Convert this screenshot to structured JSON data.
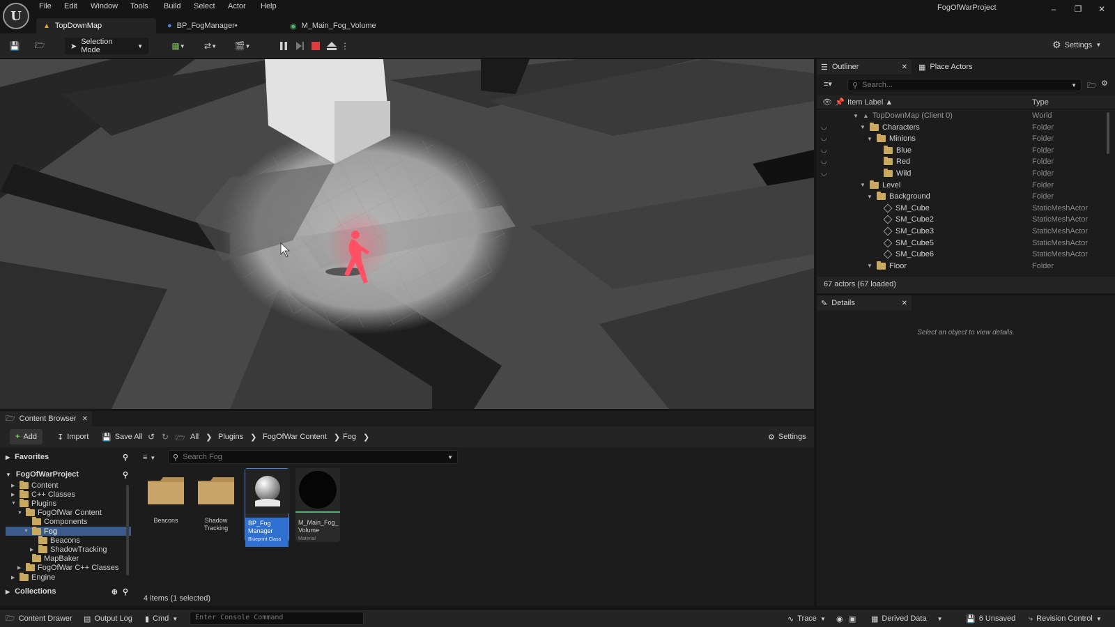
{
  "app": {
    "project_title": "FogOfWarProject",
    "menu": [
      "File",
      "Edit",
      "Window",
      "Tools",
      "Build",
      "Select",
      "Actor",
      "Help"
    ],
    "tabs": [
      {
        "label": "TopDownMap",
        "icon": "level-icon",
        "active": true
      },
      {
        "label": "BP_FogManager•",
        "icon": "blueprint-icon",
        "active": false
      },
      {
        "label": "M_Main_Fog_Volume",
        "icon": "material-icon",
        "active": false
      }
    ],
    "window_controls": [
      "minimize",
      "restore",
      "close"
    ]
  },
  "toolbar": {
    "selection_mode": "Selection Mode",
    "settings": "Settings",
    "play_state": "playing"
  },
  "outliner": {
    "tab_label": "Outliner",
    "place_actors_label": "Place Actors",
    "search_placeholder": "Search...",
    "col_label": "Item Label ▲",
    "col_type": "Type",
    "rows": [
      {
        "label": "TopDownMap (Client 0)",
        "type": "World",
        "depth": 0,
        "icon": "world-icon",
        "expanded": true,
        "eye": false
      },
      {
        "label": "Characters",
        "type": "Folder",
        "depth": 1,
        "icon": "folder-icon",
        "expanded": true,
        "eye": true
      },
      {
        "label": "Minions",
        "type": "Folder",
        "depth": 2,
        "icon": "folder-icon",
        "expanded": true,
        "eye": true
      },
      {
        "label": "Blue",
        "type": "Folder",
        "depth": 3,
        "icon": "folder-icon",
        "expanded": false,
        "eye": true
      },
      {
        "label": "Red",
        "type": "Folder",
        "depth": 3,
        "icon": "folder-icon",
        "expanded": false,
        "eye": true
      },
      {
        "label": "Wild",
        "type": "Folder",
        "depth": 3,
        "icon": "folder-icon",
        "expanded": false,
        "eye": true
      },
      {
        "label": "Level",
        "type": "Folder",
        "depth": 1,
        "icon": "folder-icon",
        "expanded": true,
        "eye": false
      },
      {
        "label": "Background",
        "type": "Folder",
        "depth": 2,
        "icon": "folder-icon",
        "expanded": true,
        "eye": false
      },
      {
        "label": "SM_Cube",
        "type": "StaticMeshActor",
        "depth": 3,
        "icon": "mesh-icon",
        "expanded": false,
        "eye": false
      },
      {
        "label": "SM_Cube2",
        "type": "StaticMeshActor",
        "depth": 3,
        "icon": "mesh-icon",
        "expanded": false,
        "eye": false
      },
      {
        "label": "SM_Cube3",
        "type": "StaticMeshActor",
        "depth": 3,
        "icon": "mesh-icon",
        "expanded": false,
        "eye": false
      },
      {
        "label": "SM_Cube5",
        "type": "StaticMeshActor",
        "depth": 3,
        "icon": "mesh-icon",
        "expanded": false,
        "eye": false
      },
      {
        "label": "SM_Cube6",
        "type": "StaticMeshActor",
        "depth": 3,
        "icon": "mesh-icon",
        "expanded": false,
        "eye": false
      },
      {
        "label": "Floor",
        "type": "Folder",
        "depth": 2,
        "icon": "folder-icon",
        "expanded": true,
        "eye": false
      }
    ],
    "footer": "67 actors (67 loaded)"
  },
  "details": {
    "tab_label": "Details",
    "empty_message": "Select an object to view details."
  },
  "content_browser": {
    "tab_label": "Content Browser",
    "add_label": "Add",
    "import_label": "Import",
    "save_all_label": "Save All",
    "breadcrumbs": [
      "All",
      "Plugins",
      "FogOfWar Content",
      "Fog"
    ],
    "settings_label": "Settings",
    "favorites_label": "Favorites",
    "project_label": "FogOfWarProject",
    "collections_label": "Collections",
    "search_placeholder": "Search Fog",
    "tree": [
      {
        "label": "Content",
        "depth": 1,
        "selected": false
      },
      {
        "label": "C++ Classes",
        "depth": 1,
        "selected": false
      },
      {
        "label": "Plugins",
        "depth": 1,
        "selected": false
      },
      {
        "label": "FogOfWar Content",
        "depth": 2,
        "selected": false
      },
      {
        "label": "Components",
        "depth": 3,
        "selected": false
      },
      {
        "label": "Fog",
        "depth": 3,
        "selected": true
      },
      {
        "label": "Beacons",
        "depth": 4,
        "selected": false
      },
      {
        "label": "ShadowTracking",
        "depth": 4,
        "selected": false
      },
      {
        "label": "MapBaker",
        "depth": 3,
        "selected": false
      },
      {
        "label": "FogOfWar C++ Classes",
        "depth": 2,
        "selected": false
      },
      {
        "label": "Engine",
        "depth": 1,
        "selected": false
      }
    ],
    "items": [
      {
        "name": "Beacons",
        "kind": "folder"
      },
      {
        "name": "Shadow Tracking",
        "kind": "folder"
      },
      {
        "name": "BP_Fog Manager",
        "kind": "asset",
        "subtype": "Blueprint Class",
        "selected": true
      },
      {
        "name": "M_Main_Fog_ Volume",
        "kind": "asset",
        "subtype": "Material",
        "selected": false
      }
    ],
    "status": "4 items (1 selected)"
  },
  "statusbar": {
    "content_drawer": "Content Drawer",
    "output_log": "Output Log",
    "cmd": "Cmd",
    "console_placeholder": "Enter Console Command",
    "trace": "Trace",
    "derived_data": "Derived Data",
    "unsaved": "6 Unsaved",
    "revision_control": "Revision Control"
  },
  "colors": {
    "accent": "#2f6fd0",
    "selection": "#3a5b8c",
    "stop": "#e03b3b",
    "character": "#ff4d62"
  }
}
